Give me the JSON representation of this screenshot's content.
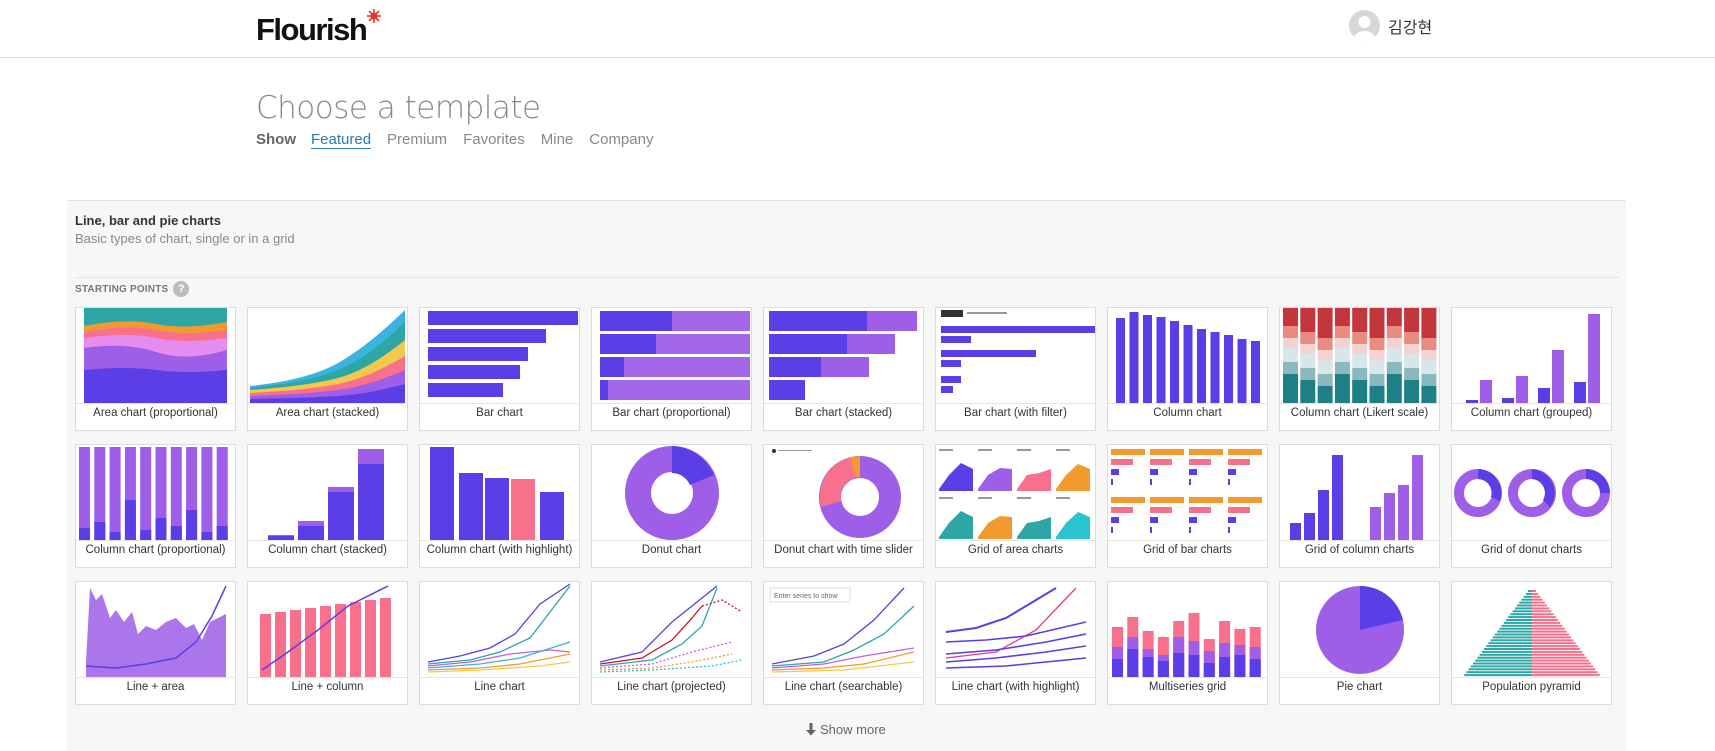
{
  "header": {
    "logo_text": "Flourish",
    "user_name": "김강현"
  },
  "page": {
    "title": "Choose a template",
    "filter_label": "Show",
    "filters": [
      "Featured",
      "Premium",
      "Favorites",
      "Mine",
      "Company"
    ],
    "active_filter": "Featured"
  },
  "section": {
    "title": "Line, bar and pie charts",
    "subtitle": "Basic types of chart, single or in a grid",
    "starting_points_label": "STARTING POINTS",
    "help": "?",
    "show_more_label": "Show more"
  },
  "templates": [
    {
      "label": "Area chart (proportional)",
      "icon": "area-proportional"
    },
    {
      "label": "Area chart (stacked)",
      "icon": "area-stacked"
    },
    {
      "label": "Bar chart",
      "icon": "bar"
    },
    {
      "label": "Bar chart (proportional)",
      "icon": "bar-proportional"
    },
    {
      "label": "Bar chart (stacked)",
      "icon": "bar-stacked"
    },
    {
      "label": "Bar chart (with filter)",
      "icon": "bar-filter"
    },
    {
      "label": "Column chart",
      "icon": "column"
    },
    {
      "label": "Column chart (Likert scale)",
      "icon": "column-likert"
    },
    {
      "label": "Column chart (grouped)",
      "icon": "column-grouped"
    },
    {
      "label": "Column chart (proportional)",
      "icon": "column-proportional"
    },
    {
      "label": "Column chart (stacked)",
      "icon": "column-stacked"
    },
    {
      "label": "Column chart (with highlight)",
      "icon": "column-highlight"
    },
    {
      "label": "Donut chart",
      "icon": "donut"
    },
    {
      "label": "Donut chart with time slider",
      "icon": "donut-slider"
    },
    {
      "label": "Grid of area charts",
      "icon": "grid-area"
    },
    {
      "label": "Grid of bar charts",
      "icon": "grid-bar"
    },
    {
      "label": "Grid of column charts",
      "icon": "grid-column"
    },
    {
      "label": "Grid of donut charts",
      "icon": "grid-donut"
    },
    {
      "label": "Line + area",
      "icon": "line-area"
    },
    {
      "label": "Line + column",
      "icon": "line-column"
    },
    {
      "label": "Line chart",
      "icon": "line"
    },
    {
      "label": "Line chart (projected)",
      "icon": "line-projected"
    },
    {
      "label": "Line chart (searchable)",
      "icon": "line-searchable",
      "thumb_text": "Enter series to show"
    },
    {
      "label": "Line chart (with highlight)",
      "icon": "line-highlight"
    },
    {
      "label": "Multiseries grid",
      "icon": "multiseries-grid"
    },
    {
      "label": "Pie chart",
      "icon": "pie"
    },
    {
      "label": "Population pyramid",
      "icon": "population-pyramid"
    }
  ],
  "colors": {
    "purple": "#5b3ee6",
    "lavender": "#9e5ee8",
    "pink": "#f9708d",
    "orange": "#f39a2e",
    "teal": "#2ea6a6",
    "brand_red": "#e8342a",
    "link": "#2a7bb3"
  }
}
